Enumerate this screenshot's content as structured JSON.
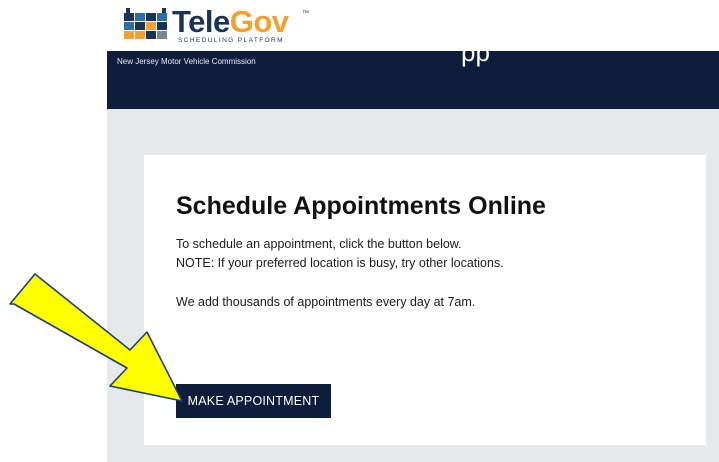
{
  "logo": {
    "word_part1": "Tele",
    "word_part2": "Gov",
    "trademark": "™",
    "tagline": "SCHEDULING PLATFORM",
    "grid_colors": [
      "#1a3358",
      "#2a6fa8",
      "#f3a12d",
      "#7a8793"
    ]
  },
  "header": {
    "agency": "New Jersey Motor Vehicle Commission",
    "title_fragment": "pp"
  },
  "card": {
    "title": "Schedule Appointments Online",
    "line1": "To schedule an appointment, click the button below.",
    "line2": "NOTE: If your preferred location is busy, try other locations.",
    "line3": "We add thousands of appointments every day at 7am.",
    "button_label": "MAKE APPOINTMENT"
  },
  "annotation": {
    "arrow_color": "#ffff00",
    "arrow_outline": "#1f3f7a"
  },
  "colors": {
    "navy": "#0f1d3d",
    "content_bg": "#e7e8ea",
    "accent_orange": "#f3a12d"
  }
}
